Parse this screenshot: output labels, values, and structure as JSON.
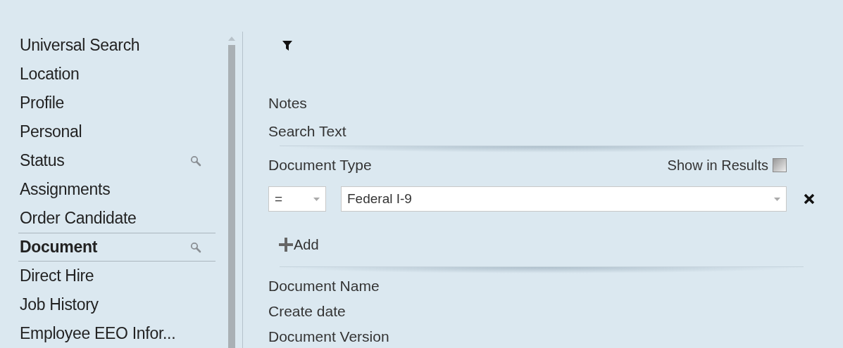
{
  "sidebar": {
    "items": [
      {
        "label": "Universal Search",
        "selected": false,
        "searchable": false
      },
      {
        "label": "Location",
        "selected": false,
        "searchable": false
      },
      {
        "label": "Profile",
        "selected": false,
        "searchable": false
      },
      {
        "label": "Personal",
        "selected": false,
        "searchable": false
      },
      {
        "label": "Status",
        "selected": false,
        "searchable": true
      },
      {
        "label": "Assignments",
        "selected": false,
        "searchable": false
      },
      {
        "label": "Order Candidate",
        "selected": false,
        "searchable": false
      },
      {
        "label": "Document",
        "selected": true,
        "searchable": true
      },
      {
        "label": "Direct Hire",
        "selected": false,
        "searchable": false
      },
      {
        "label": "Job History",
        "selected": false,
        "searchable": false
      },
      {
        "label": "Employee EEO Infor...",
        "selected": false,
        "searchable": false
      }
    ]
  },
  "fields_top": [
    "Notes",
    "Search Text"
  ],
  "document_type": {
    "label": "Document Type",
    "show_in_results": {
      "label": "Show in Results",
      "checked": false
    },
    "operator": "=",
    "value": "Federal I-9",
    "add": "Add"
  },
  "fields_bottom": [
    "Document Name",
    "Create date",
    "Document Version"
  ]
}
